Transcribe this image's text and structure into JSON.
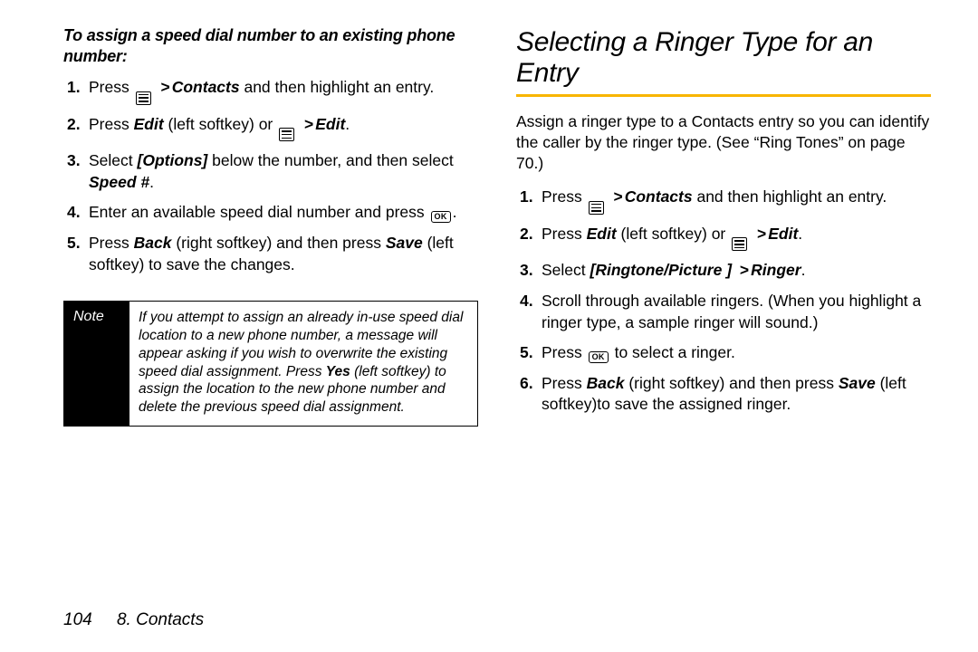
{
  "left": {
    "subhead": "To assign a speed dial number to an existing phone number:",
    "steps": [
      {
        "num": "1.",
        "parts": [
          "Press ",
          {
            "icon": "menu"
          },
          " ",
          {
            "gt": ">"
          },
          {
            "bi": "Contacts"
          },
          " and then highlight an entry."
        ]
      },
      {
        "num": "2.",
        "parts": [
          "Press ",
          {
            "bi": "Edit"
          },
          " (left softkey) or ",
          {
            "icon": "menu"
          },
          " ",
          {
            "gt": ">"
          },
          {
            "bi": "Edit"
          },
          "."
        ]
      },
      {
        "num": "3.",
        "parts": [
          "Select ",
          {
            "bi": "[Options]"
          },
          " below the number, and then select ",
          {
            "bi": "Speed #"
          },
          "."
        ]
      },
      {
        "num": "4.",
        "parts": [
          "Enter an available speed dial number and press ",
          {
            "icon": "ok"
          },
          "."
        ]
      },
      {
        "num": "5.",
        "parts": [
          "Press ",
          {
            "bi": "Back"
          },
          " (right softkey) and then press ",
          {
            "bi": "Save"
          },
          " (left softkey) to save the changes."
        ]
      }
    ],
    "note": {
      "label": "Note",
      "parts": [
        "If you attempt to assign an already in-use speed dial location to a new phone number, a message will appear asking if you wish to overwrite the existing speed dial assignment. Press ",
        {
          "b": "Yes"
        },
        " (left softkey) to assign the location to the new phone number and delete the previous speed dial assignment."
      ]
    }
  },
  "right": {
    "title": "Selecting a Ringer Type for an Entry",
    "intro": "Assign a ringer type to a Contacts entry so you can identify the caller by the ringer type. (See “Ring Tones” on page 70.)",
    "steps": [
      {
        "num": "1.",
        "parts": [
          "Press ",
          {
            "icon": "menu"
          },
          " ",
          {
            "gt": ">"
          },
          {
            "bi": "Contacts"
          },
          " and then highlight an entry."
        ]
      },
      {
        "num": "2.",
        "parts": [
          "Press ",
          {
            "bi": "Edit"
          },
          " (left softkey) or ",
          {
            "icon": "menu"
          },
          " ",
          {
            "gt": ">"
          },
          {
            "bi": "Edit"
          },
          "."
        ]
      },
      {
        "num": "3.",
        "parts": [
          "Select ",
          {
            "bi": "[Ringtone/Picture ]"
          },
          " ",
          {
            "gt": ">"
          },
          {
            "bi": "Ringer"
          },
          "."
        ]
      },
      {
        "num": "4.",
        "parts": [
          "Scroll through available ringers. (When you highlight a ringer type, a sample ringer will sound.)"
        ]
      },
      {
        "num": "5.",
        "parts": [
          "Press ",
          {
            "icon": "ok"
          },
          " to select a ringer."
        ]
      },
      {
        "num": "6.",
        "parts": [
          "Press ",
          {
            "bi": "Back"
          },
          " (right softkey) and then press ",
          {
            "bi": "Save"
          },
          " (left softkey)to save the assigned ringer."
        ]
      }
    ]
  },
  "footer": {
    "page": "104",
    "section": "8. Contacts"
  }
}
